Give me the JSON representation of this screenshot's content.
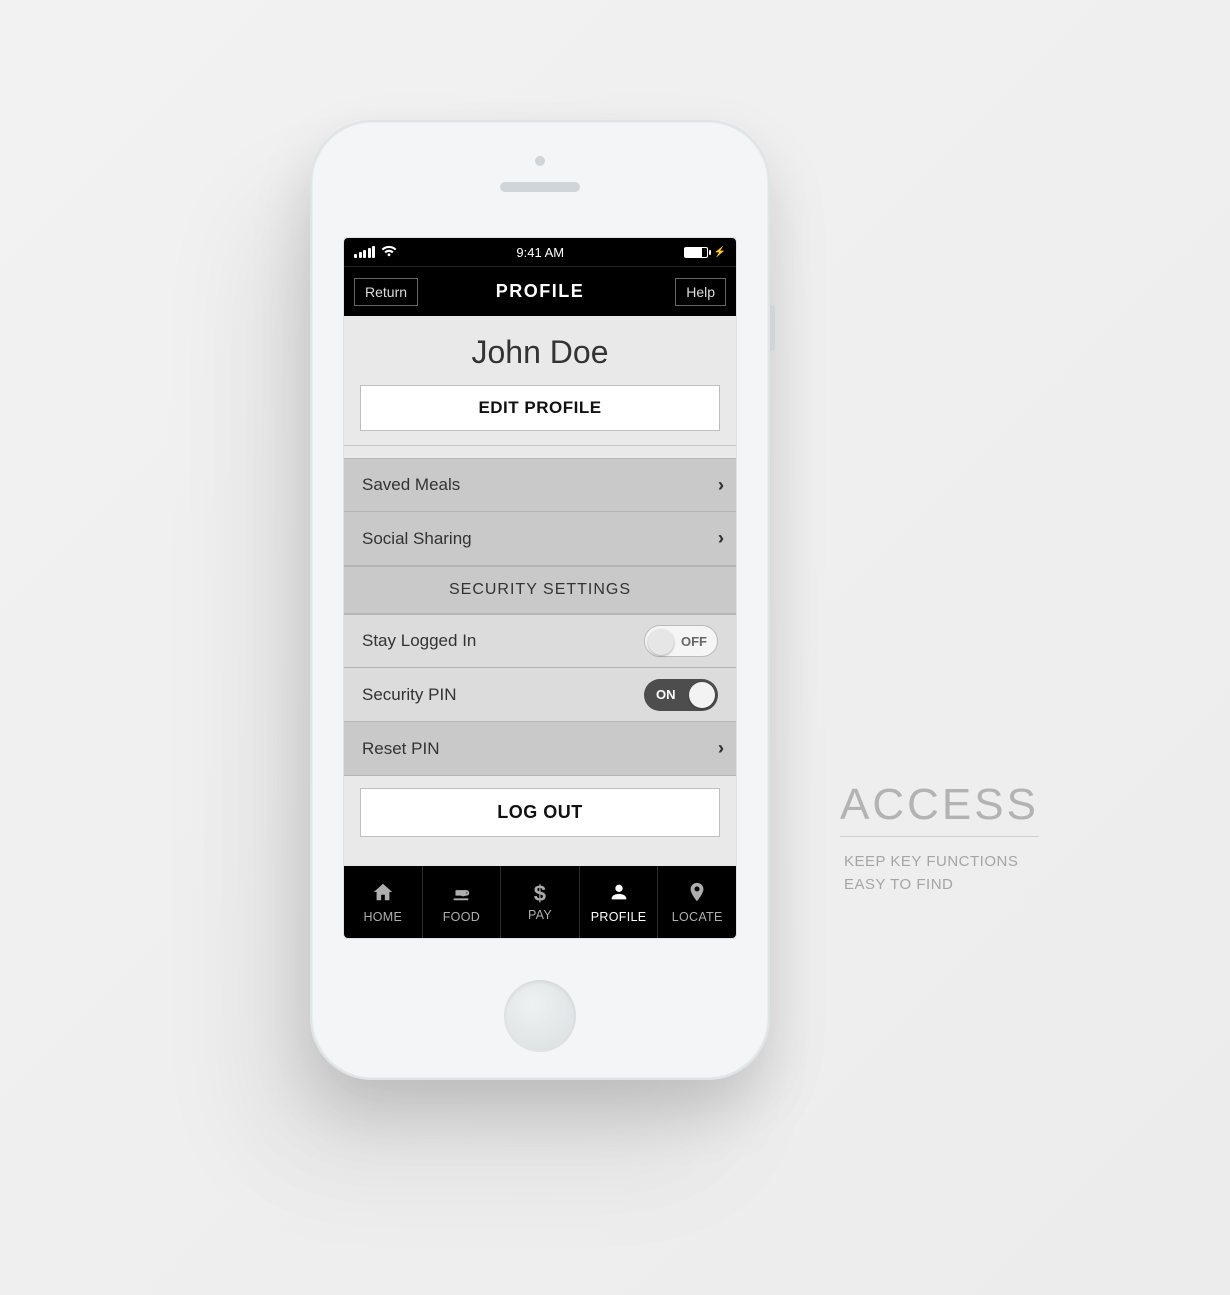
{
  "statusbar": {
    "time": "9:41 AM"
  },
  "navbar": {
    "return_label": "Return",
    "title": "PROFILE",
    "help_label": "Help"
  },
  "profile": {
    "name": "John Doe",
    "edit_label": "EDIT PROFILE"
  },
  "rows": {
    "saved_meals": "Saved Meals",
    "social_sharing": "Social Sharing",
    "section_security": "SECURITY SETTINGS",
    "stay_logged_in": "Stay Logged In",
    "security_pin": "Security PIN",
    "reset_pin": "Reset PIN"
  },
  "toggles": {
    "off_label": "OFF",
    "on_label": "ON"
  },
  "logout": {
    "label": "LOG OUT"
  },
  "tabs": {
    "home": "HOME",
    "food": "FOOD",
    "pay": "PAY",
    "profile": "PROFILE",
    "locate": "LOCATE"
  },
  "callout": {
    "title": "ACCESS",
    "line1": "KEEP KEY FUNCTIONS",
    "line2": "EASY TO FIND"
  }
}
